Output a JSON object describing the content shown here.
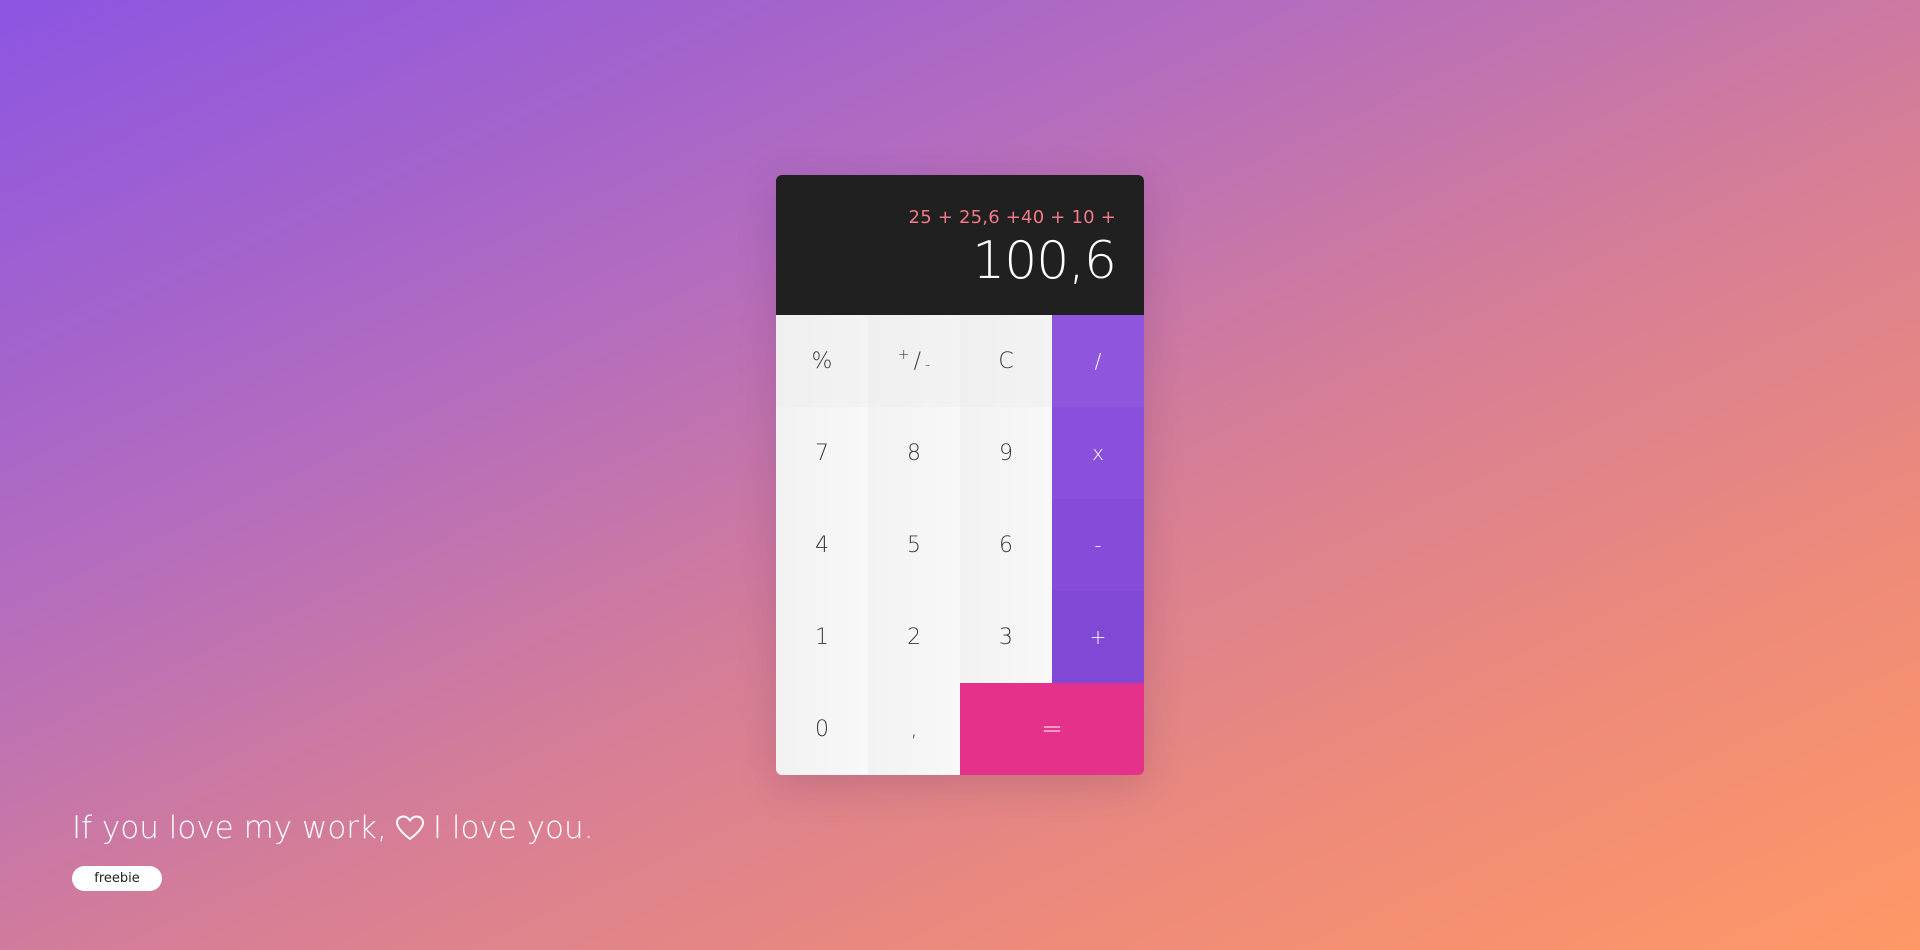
{
  "calculator": {
    "expression": "25 + 25,6 +40 + 10 +",
    "result": "100,6",
    "keys": {
      "percent": "%",
      "plus_minus_plus": "+",
      "plus_minus_slash": "/",
      "plus_minus_minus": "-",
      "clear": "C",
      "divide": "/",
      "seven": "7",
      "eight": "8",
      "nine": "9",
      "multiply": "x",
      "four": "4",
      "five": "5",
      "six": "6",
      "subtract": "-",
      "one": "1",
      "two": "2",
      "three": "3",
      "add": "+",
      "zero": "0",
      "decimal": ",",
      "equals": "="
    },
    "colors": {
      "display_bg": "#202020",
      "expression": "#f07b88",
      "operator": "#8f55dd",
      "equals": "#e4318a"
    }
  },
  "footer": {
    "text_before": "If you love my work,",
    "heart_icon": "heart-outline-icon",
    "text_after": "I love you.",
    "badge": "freebie"
  }
}
